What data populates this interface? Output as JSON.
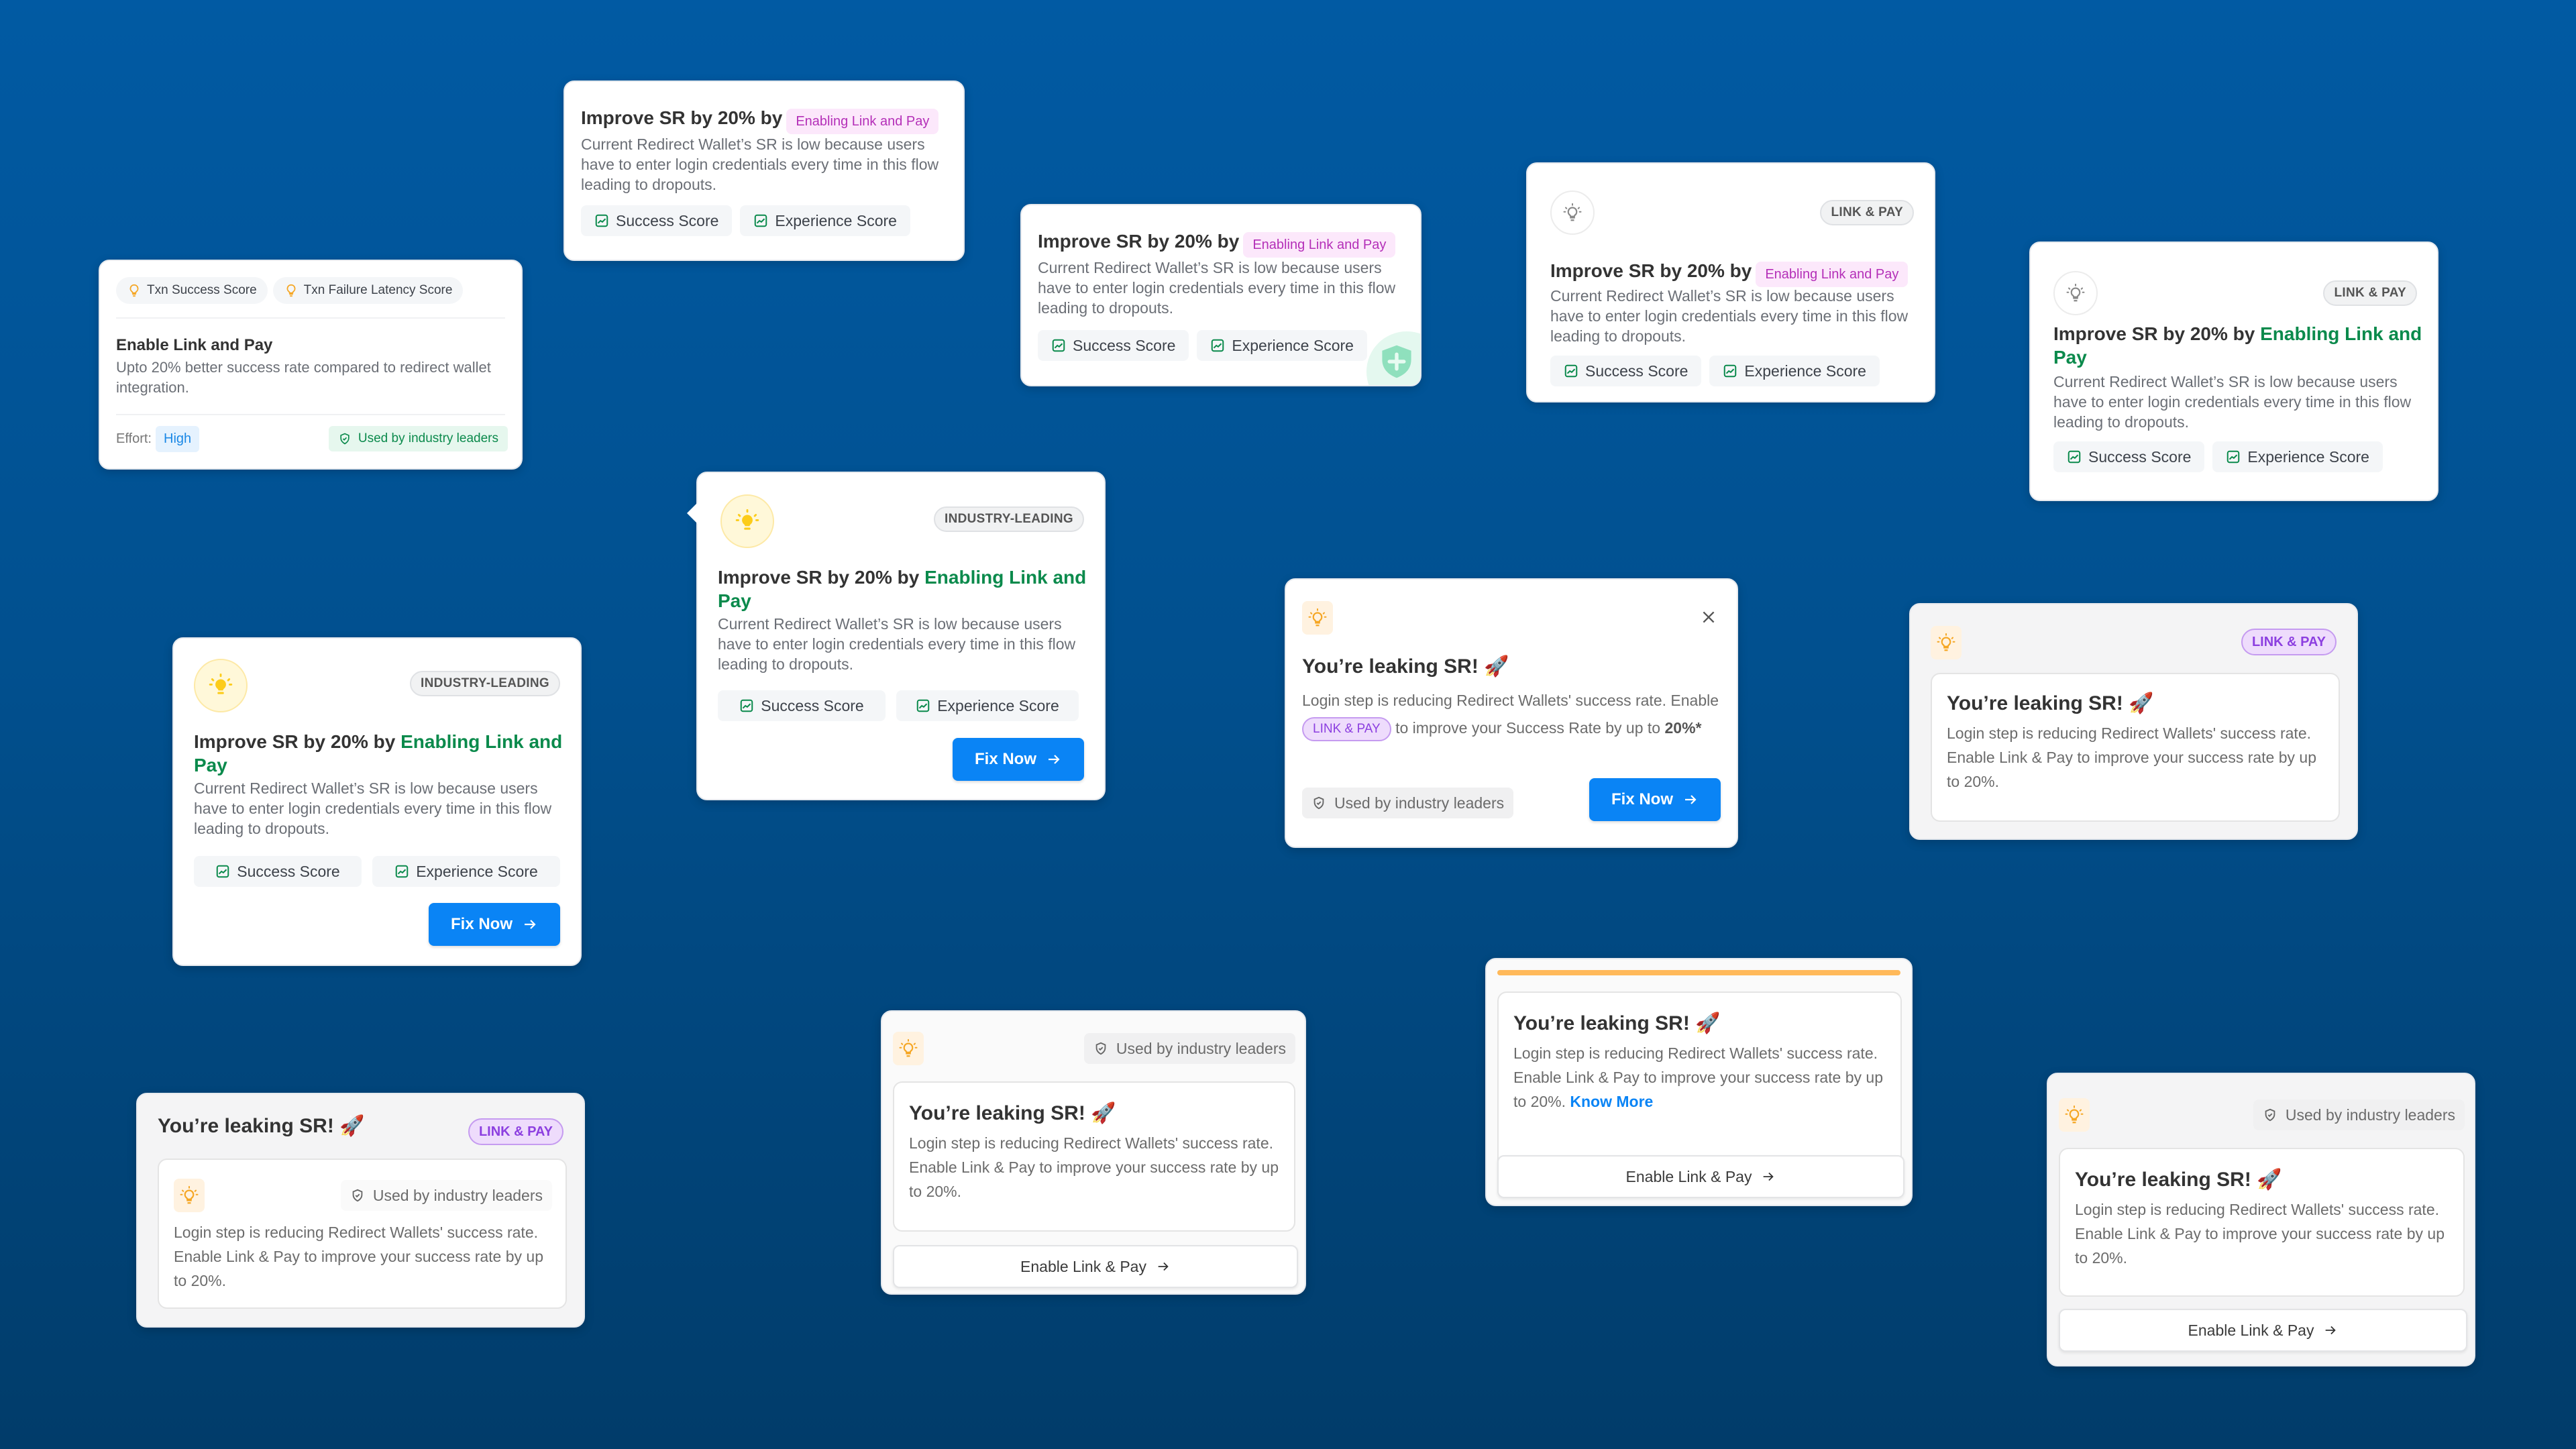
{
  "background": {
    "top_color": "#015aa3",
    "bottom_color": "#013c6a"
  },
  "colors": {
    "green": "#0b8a4c",
    "blue_button": "#0a84f5",
    "pink_pill_text": "#b42fb8",
    "purple_tag_text": "#8c3fe0",
    "amber_bar": "#ffb95a"
  },
  "common": {
    "improve_prefix": "Improve SR by 20% by",
    "improve_highlight": "Enabling Link and Pay",
    "improve_desc": "Current Redirect Wallet’s SR is low because users have to enter login credentials every time in this flow leading to dropouts.",
    "chip_success": "Success Score",
    "chip_experience": "Experience Score",
    "leak_title": "You’re leaking SR! 🚀",
    "leak_desc": "Login step is reducing Redirect Wallets' success rate. Enable Link & Pay to improve your success rate by up to 20%.",
    "used_by": "Used by industry leaders",
    "fix_now": "Fix Now",
    "enable_btn": "Enable Link & Pay",
    "link_pay_tag": "LINK & PAY",
    "industry_tag": "INDUSTRY-LEADING"
  },
  "card_txn": {
    "chip1": "Txn Success Score",
    "chip2": "Txn Failure Latency Score",
    "title": "Enable Link and Pay",
    "desc": "Upto 20% better success rate compared to redirect wallet integration.",
    "effort_label": "Effort:",
    "effort_value": "High",
    "used_by": "Used by industry leaders"
  },
  "card_close": {
    "title": "You’re leaking SR! 🚀",
    "desc_a": "Login step is reducing Redirect Wallets' success rate. Enable",
    "inline_tag": "LINK & PAY",
    "desc_b": "to improve your Success Rate by up to",
    "desc_bold": "20%*"
  },
  "card_knowmore": {
    "desc": "Login step is reducing Redirect Wallets' success rate. Enable Link & Pay to improve your success rate by up to 20%.",
    "link": "Know More"
  }
}
